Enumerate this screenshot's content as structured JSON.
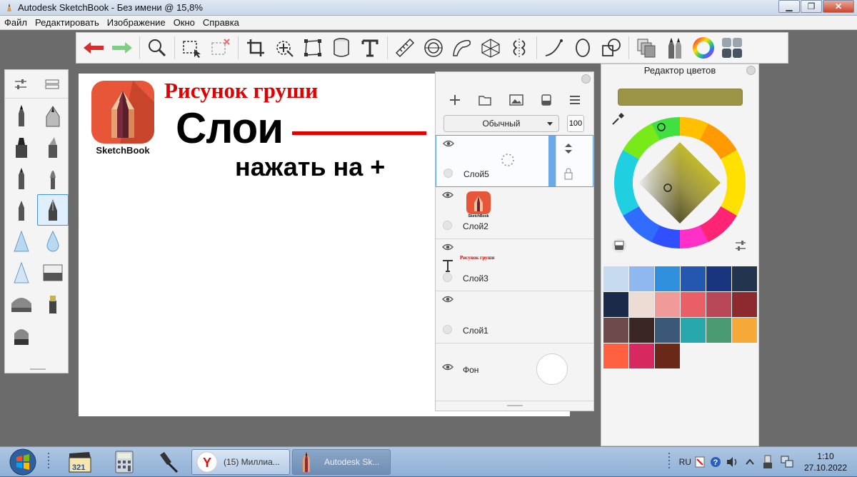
{
  "window": {
    "title": "Autodesk SketchBook - Без имени @ 15,8%",
    "minimize_label": "▁",
    "maximize_label": "❐",
    "close_label": "✕"
  },
  "menu": [
    "Файл",
    "Редактировать",
    "Изображение",
    "Окно",
    "Справка"
  ],
  "toolbar": {
    "icons": [
      "undo-icon",
      "redo-icon",
      "zoom-icon",
      "select-icon",
      "clear-selection-icon",
      "crop-icon",
      "transform-icon",
      "distort-icon",
      "fill-icon",
      "text-icon",
      "ruler-icon",
      "ellipse-guide-icon",
      "french-curve-icon",
      "perspective-icon",
      "symmetry-icon",
      "stroke-icon",
      "ellipse-icon",
      "shape-icon",
      "copy-paste-icon",
      "brushes-icon",
      "color-wheel-icon",
      "layers-icon"
    ],
    "colors": {
      "undo": "#d32f2f",
      "redo": "#6fbf73"
    }
  },
  "brush_palette": {
    "selected_index": 7
  },
  "canvas": {
    "logo_label": "SketchBook",
    "title": "Рисунок груши",
    "heading": "Слои",
    "instruction": "нажать на +"
  },
  "layer_editor": {
    "blend_mode": "Обычный",
    "opacity": "100",
    "layers": [
      {
        "name": "Слой5",
        "active": true
      },
      {
        "name": "Слой2",
        "thumb": "logo",
        "thumb_label": "SketchBook"
      },
      {
        "name": "Слой3",
        "thumb": "text",
        "thumb_label": "Рисунок груши"
      },
      {
        "name": "Слой1"
      }
    ],
    "background": {
      "name": "Фон"
    }
  },
  "color_editor": {
    "title": "Редактор цветов",
    "current_color": "#9b9447",
    "palette": [
      "#c6dbef",
      "#8fb8f0",
      "#2f8fdc",
      "#2357b0",
      "#1a3580",
      "#22344e",
      "#1c2a4a",
      "#ecdcd4",
      "#f09a9a",
      "#e85f68",
      "#b84858",
      "#8c2a30",
      "#6e4a4c",
      "#3a2624",
      "#3c5878",
      "#28a8ac",
      "#4a9a72",
      "#f6a838",
      "#ff6040",
      "#d82860",
      "#6a2818"
    ]
  },
  "taskbar": {
    "tasks": [
      {
        "label": "(15) Миллиа...",
        "icon": "yandex-browser-icon"
      },
      {
        "label": "Autodesk Sk...",
        "icon": "sketchbook-icon",
        "active": true
      }
    ],
    "language": "RU",
    "time": "1:10",
    "date": "27.10.2022"
  }
}
